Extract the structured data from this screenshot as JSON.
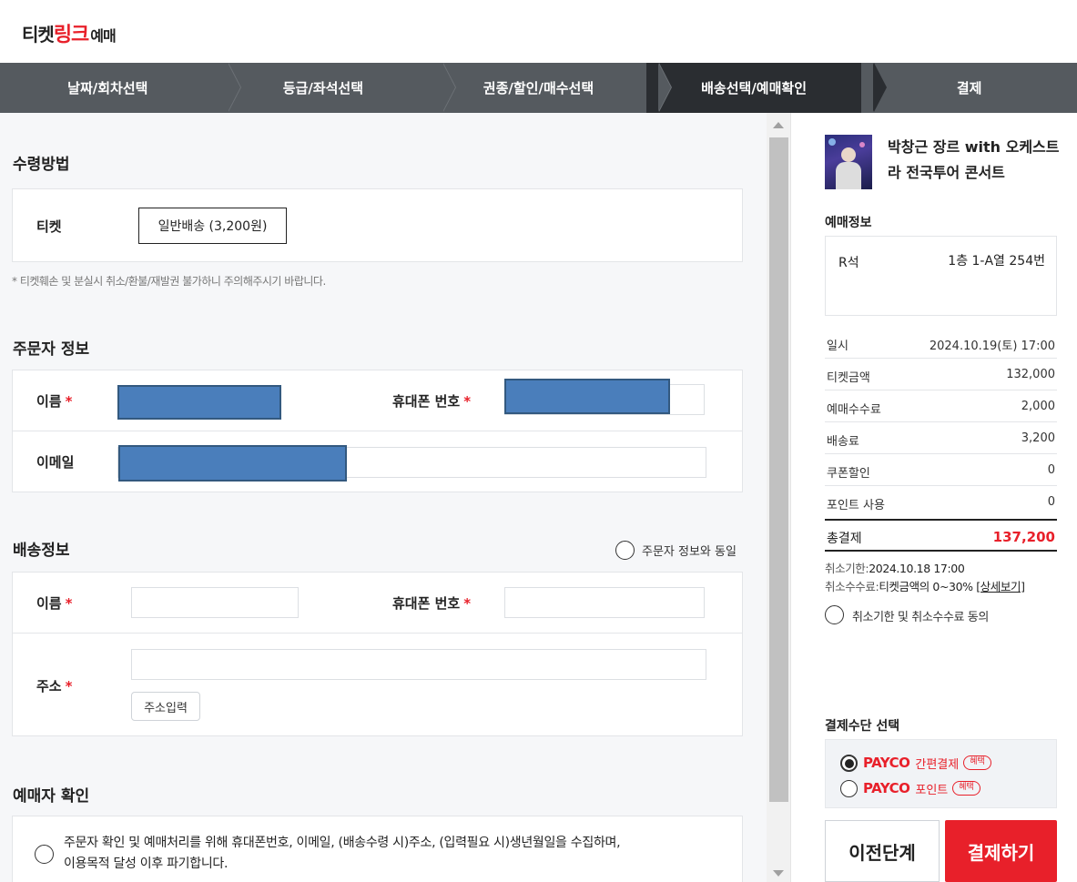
{
  "header": {
    "logo_part1": "티켓",
    "logo_part2": "링크",
    "logo_part3": "예매"
  },
  "steps": [
    {
      "label": "날짜/회차선택",
      "active": false
    },
    {
      "label": "등급/좌석선택",
      "active": false
    },
    {
      "label": "권종/할인/매수선택",
      "active": false
    },
    {
      "label": "배송선택/예매확인",
      "active": true
    },
    {
      "label": "결제",
      "active": false
    }
  ],
  "receive": {
    "title": "수령방법",
    "ticket_label": "티켓",
    "delivery_option": "일반배송 (3,200원)",
    "note": "* 티켓훼손 및 분실시 취소/환불/재발권 불가하니 주의해주시기 바랍니다."
  },
  "orderer": {
    "title": "주문자 정보",
    "name_label": "이름",
    "phone_label": "휴대폰 번호",
    "email_label": "이메일",
    "required_mark": "*"
  },
  "delivery": {
    "title": "배송정보",
    "same_as_orderer": "주문자 정보와 동일",
    "name_label": "이름",
    "phone_label": "휴대폰 번호",
    "address_label": "주소",
    "address_button": "주소입력",
    "required_mark": "*"
  },
  "booker_confirm": {
    "title": "예매자 확인",
    "text_line1": "주문자 확인 및 예매처리를 위해 휴대폰번호, 이메일, (배송수령 시)주소, (입력필요 시)생년월일을 수집하며,",
    "text_line2": "이용목적 달성 이후 파기합니다."
  },
  "summary": {
    "concert_title": "박창근 장르 with 오케스트라 전국투어 콘서트",
    "booking_info_title": "예매정보",
    "seat_grade": "R석",
    "seat_number": "1층 1-A열 254번",
    "rows": [
      {
        "key": "일시",
        "value": "2024.10.19(토) 17:00"
      },
      {
        "key": "티켓금액",
        "value": "132,000"
      },
      {
        "key": "예매수수료",
        "value": "2,000"
      },
      {
        "key": "배송료",
        "value": "3,200"
      },
      {
        "key": "쿠폰할인",
        "value": "0"
      },
      {
        "key": "포인트 사용",
        "value": "0"
      }
    ],
    "total_label": "총결제",
    "total_value": "137,200",
    "cancel_deadline_label": "취소기한:",
    "cancel_deadline": "2024.10.18 17:00",
    "cancel_fee_label": "취소수수료:",
    "cancel_fee": "티켓금액의 0~30%",
    "detail_link": "[상세보기]",
    "agree_label": "취소기한 및 취소수수료 동의",
    "payment_method_title": "결제수단 선택",
    "pay_options": [
      {
        "brand": "PAYCO",
        "label": "간편결제",
        "badge": "혜택",
        "selected": true
      },
      {
        "brand": "PAYCO",
        "label": "포인트",
        "badge": "혜택",
        "selected": false
      }
    ],
    "prev_button": "이전단계",
    "pay_button": "결제하기"
  },
  "colors": {
    "accent": "#e8202a",
    "step_bg": "#555a5f",
    "step_active_bg": "#2a2d31",
    "redaction": "#4a7ebb"
  }
}
